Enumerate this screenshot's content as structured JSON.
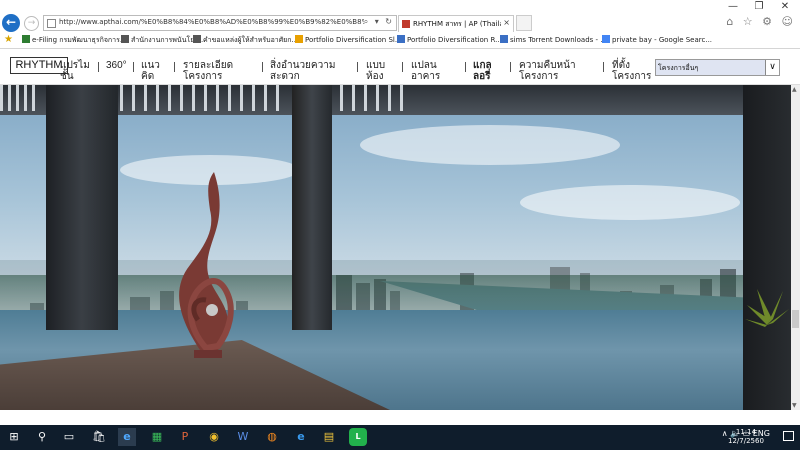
{
  "window": {
    "minimize": "—",
    "maximize": "❐",
    "close": "✕"
  },
  "browser": {
    "url": "http://www.apthai.com/%E0%B8%84%E0%B8%AD%E0%B8%99%E0%B9%82%E0%B8%94/rhythm/r",
    "tab_title": "RHYTHM สาทร | AP (Thailan...",
    "tab_close": "×",
    "address_tools": "⌕ ▾ ↻",
    "right_icons": "⌂ ☆ ⚙ ☺"
  },
  "favorites": [
    {
      "label": "e-Filing กรมพัฒนาธุรกิจการ...",
      "color": "#2e7d32"
    },
    {
      "label": "สำนักงานการพนันโยบ...",
      "color": "#555555"
    },
    {
      "label": "คำขอแหล่งผู้ให้สำหรับอาศัยก...",
      "color": "#555555"
    },
    {
      "label": "Portfolio Diversification Sl...",
      "color": "#e8a000"
    },
    {
      "label": "Portfolio Diversification R...",
      "color": "#3b6fc4"
    },
    {
      "label": "sims Torrent Downloads - ...",
      "color": "#3b6fc4"
    },
    {
      "label": "private bay - Google Searc...",
      "color": "#4285f4"
    }
  ],
  "site": {
    "logo": "RHYTHM",
    "nav": [
      {
        "l1": "แปรไม",
        "l2": "ชั้น"
      },
      {
        "l1": "360°",
        "l2": ""
      },
      {
        "l1": "แนว",
        "l2": "คิด"
      },
      {
        "l1": "รายละเอียด",
        "l2": "โครงการ"
      },
      {
        "l1": "สิ่งอำนวยความ",
        "l2": "สะดวก"
      },
      {
        "l1": "แบบ",
        "l2": "ห้อง"
      },
      {
        "l1": "แปลน",
        "l2": "อาคาร"
      },
      {
        "l1": "แกล",
        "l2": "ลอรี่"
      },
      {
        "l1": "ความคืบหน้า",
        "l2": "โครงการ"
      },
      {
        "l1": "ที่ตั้ง",
        "l2": "โครงการ"
      }
    ],
    "project_select": "โครงการอื่นๆ",
    "select_arrow": "∨"
  },
  "taskbar": {
    "start": "⊞",
    "search": "⚲",
    "taskview": "▭",
    "apps": [
      "🛍",
      "e",
      "▦",
      "P",
      "◉",
      "W",
      "◍",
      "e",
      "▤",
      "L"
    ],
    "tray": "∧ 🔈 ▭ ENG",
    "time": "11:14",
    "date": "12/7/2560"
  },
  "scroll": {
    "up": "▲",
    "down": "▼"
  }
}
